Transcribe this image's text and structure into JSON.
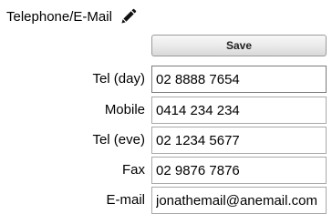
{
  "header": {
    "title": "Telephone/E-Mail",
    "edit_icon": "pencil-icon"
  },
  "toolbar": {
    "save_label": "Save"
  },
  "fields": [
    {
      "label": "Tel (day)",
      "value": "02 8888 7654"
    },
    {
      "label": "Mobile",
      "value": "0414 234 234"
    },
    {
      "label": "Tel (eve)",
      "value": "02 1234 5677"
    },
    {
      "label": "Fax",
      "value": "02 9876 7876"
    },
    {
      "label": "E-mail",
      "value": "jonathemail@anemail.com"
    }
  ]
}
